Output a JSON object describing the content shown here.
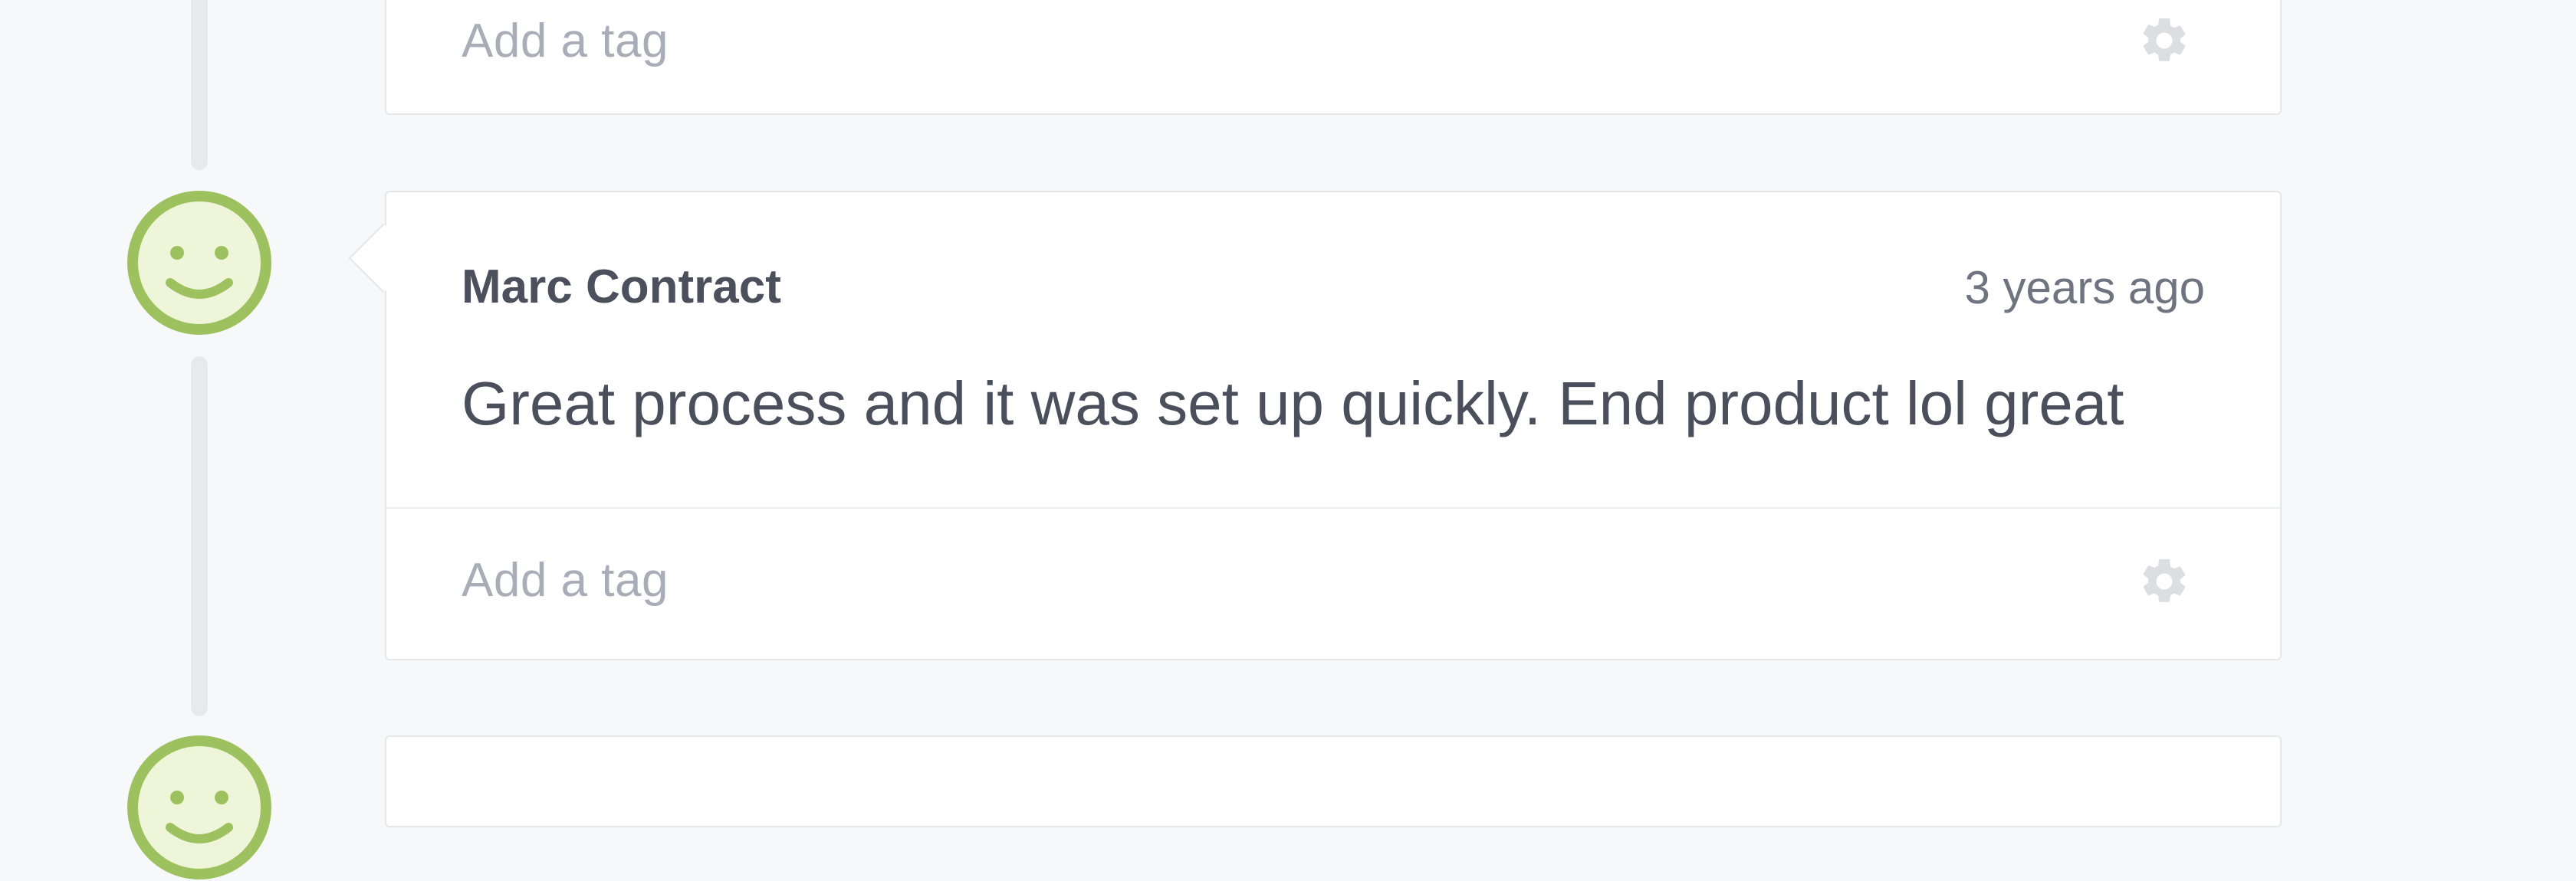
{
  "feed": {
    "items": [
      {
        "tag_placeholder": "Add a tag",
        "settings_icon": "gear-icon"
      },
      {
        "sentiment_icon": "smiley-face-icon",
        "author": "Marc Contract",
        "time": "3 years ago",
        "text": "Great process and it was set up quickly. End product lol great",
        "tag_placeholder": "Add a tag",
        "settings_icon": "gear-icon"
      },
      {
        "sentiment_icon": "smiley-face-icon"
      }
    ]
  },
  "colors": {
    "sentiment_positive": "#9ec15f",
    "sentiment_positive_fill": "#eef5d8",
    "gear": "#dcdee2",
    "timeline": "#e8e9eb"
  }
}
